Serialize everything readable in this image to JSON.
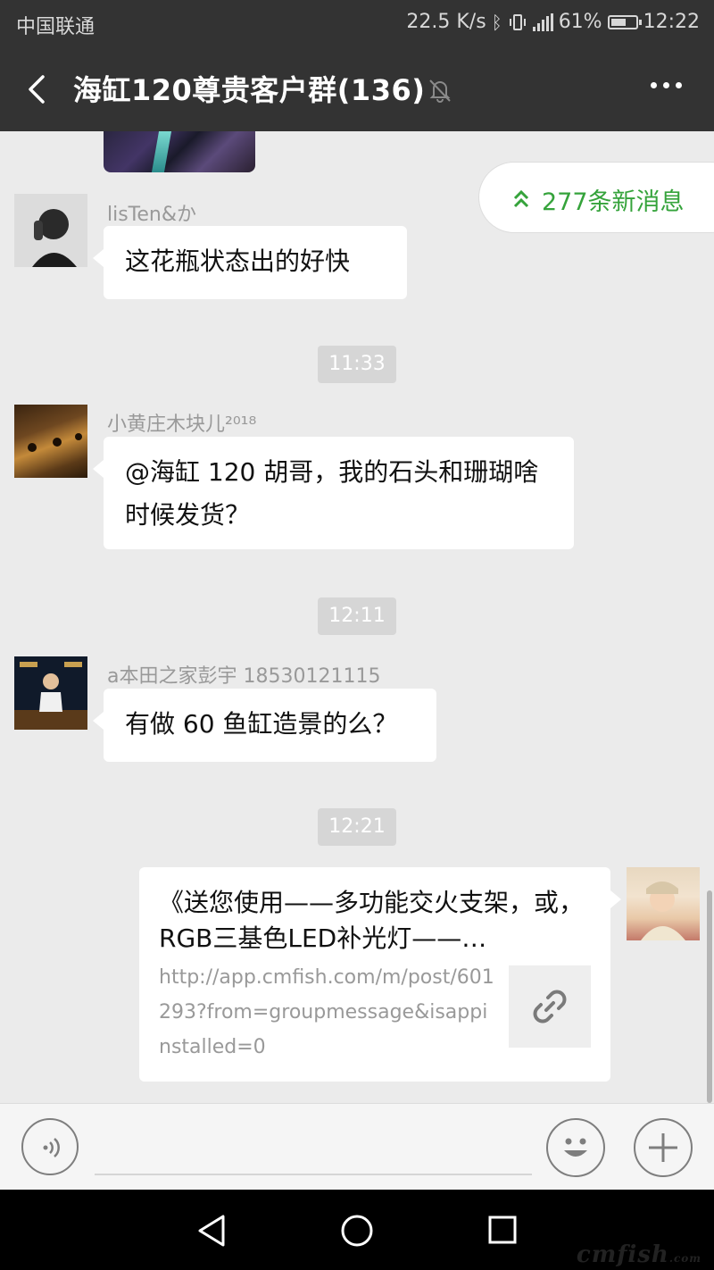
{
  "status_bar": {
    "carrier": "中国联通",
    "network_speed": "22.5 K/s",
    "battery_percent": "61%",
    "time": "12:22"
  },
  "header": {
    "title": "海缸120尊贵客户群(136)",
    "back_icon": "back-arrow-icon",
    "mute_icon": "muted-bell-icon",
    "more_icon": "more-dots-icon"
  },
  "new_messages": {
    "label": "277条新消息",
    "color": "#35a33b"
  },
  "messages": [
    {
      "sender": "lisTen&か",
      "text": "这花瓶状态出的好快"
    },
    {
      "sender": "小黄庄木块儿²⁰¹⁸",
      "text": "@海缸 120  胡哥，我的石头和珊瑚啥时候发货？"
    },
    {
      "sender": "a本田之家彭宇 18530121115",
      "text": "有做 60 鱼缸造景的么？"
    }
  ],
  "timestamps": [
    "11:33",
    "12:11",
    "12:21"
  ],
  "link_card": {
    "title": "《送您使用——多功能交火支架，或，RGB三基色LED补光灯——…",
    "url": "http://app.cmfish.com/m/post/601293?from=groupmessage&isappinstalled=0",
    "thumb_icon": "link-icon"
  },
  "input_bar": {
    "voice_icon": "voice-icon",
    "emoji_icon": "emoji-icon",
    "plus_icon": "plus-icon",
    "text_value": ""
  },
  "watermark": {
    "brand": "cmfish",
    "suffix": ".com"
  },
  "colors": {
    "bar_dark": "#333333",
    "chat_bg": "#ebebeb",
    "bubble_bg": "#ffffff",
    "timestamp_bg": "#d6d6d6"
  }
}
